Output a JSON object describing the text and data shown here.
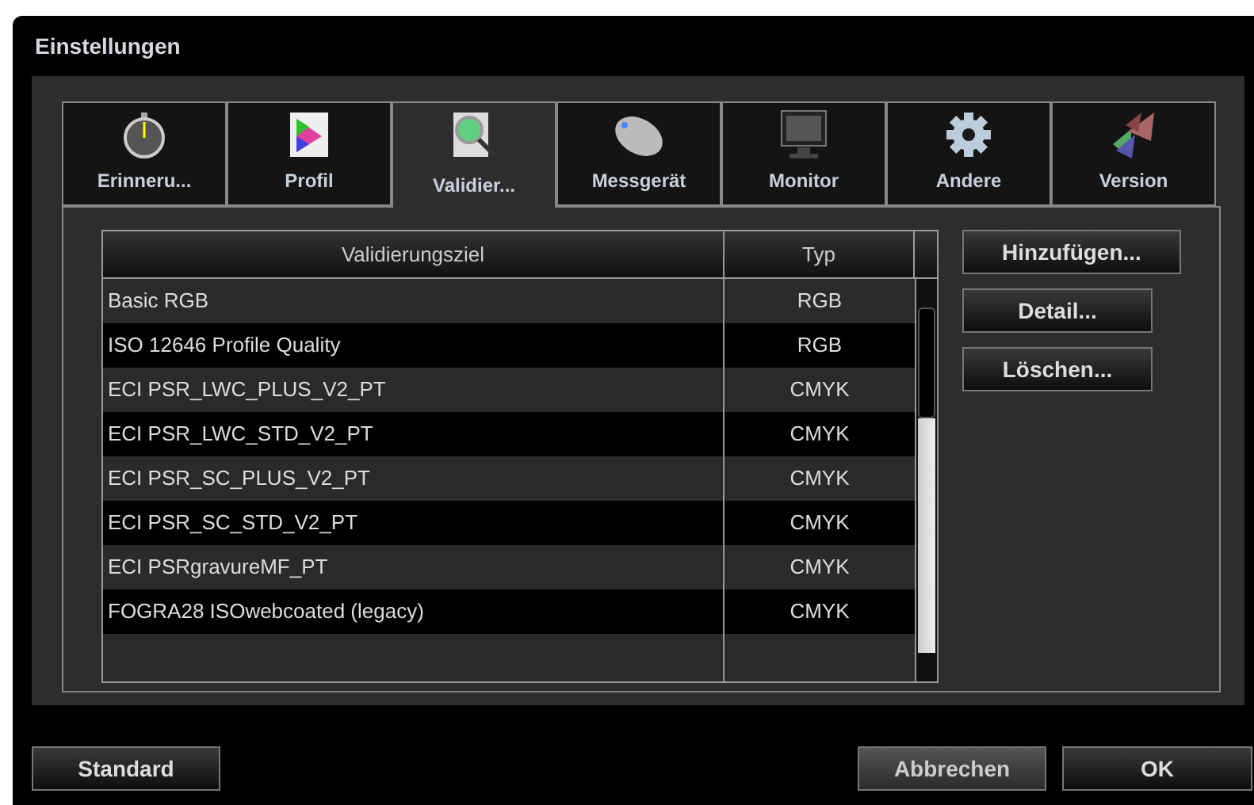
{
  "window": {
    "title": "Einstellungen"
  },
  "tabs": [
    {
      "label": "Erinneru...",
      "kind": "stopwatch",
      "selected": false
    },
    {
      "label": "Profil",
      "kind": "profile",
      "selected": false
    },
    {
      "label": "Validier...",
      "kind": "validate",
      "selected": true
    },
    {
      "label": "Messgerät",
      "kind": "mouse",
      "selected": false
    },
    {
      "label": "Monitor",
      "kind": "monitor",
      "selected": false
    },
    {
      "label": "Andere",
      "kind": "gear",
      "selected": false
    },
    {
      "label": "Version",
      "kind": "butterfly",
      "selected": false
    }
  ],
  "table": {
    "columns": [
      "Validierungsziel",
      "Typ"
    ],
    "rows": [
      {
        "name": "Basic RGB",
        "type": "RGB"
      },
      {
        "name": "ISO 12646 Profile Quality",
        "type": "RGB"
      },
      {
        "name": "ECI PSR_LWC_PLUS_V2_PT",
        "type": "CMYK"
      },
      {
        "name": "ECI PSR_LWC_STD_V2_PT",
        "type": "CMYK"
      },
      {
        "name": "ECI PSR_SC_PLUS_V2_PT",
        "type": "CMYK"
      },
      {
        "name": "ECI PSR_SC_STD_V2_PT",
        "type": "CMYK"
      },
      {
        "name": "ECI PSRgravureMF_PT",
        "type": "CMYK"
      },
      {
        "name": "FOGRA28 ISOwebcoated (legacy)",
        "type": "CMYK"
      }
    ]
  },
  "side_buttons": [
    "Hinzufügen...",
    "Detail...",
    "Löschen..."
  ],
  "footer": {
    "left": "Standard",
    "cancel": "Abbrechen",
    "ok": "OK"
  }
}
